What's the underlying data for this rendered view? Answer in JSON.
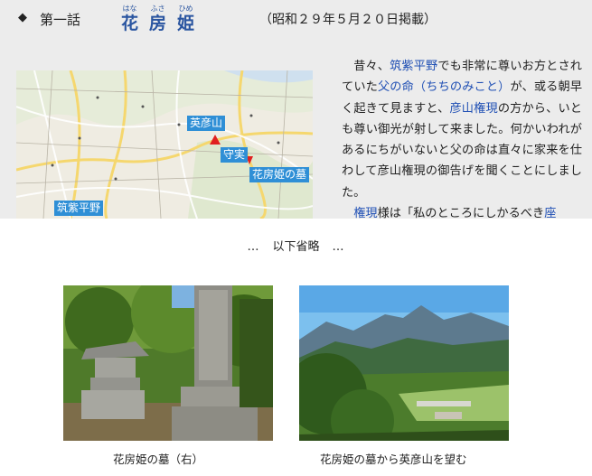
{
  "header": {
    "marker_icon": "diamond",
    "episode_label": "第一話",
    "title_chars": [
      {
        "rb": "花",
        "rt": "はな"
      },
      {
        "rb": "房",
        "rt": "ふさ"
      },
      {
        "rb": "姫",
        "rt": "ひめ"
      }
    ],
    "date": "（昭和２９年５月２０日掲載）"
  },
  "map": {
    "labels": {
      "hikosan": "英彦山",
      "moriza": "守実",
      "tomb": "花房姫の墓",
      "chikushi": "筑紫平野"
    },
    "markers": {
      "hikosan_color": "#e02020",
      "tomb_color": "#e02020"
    }
  },
  "story": {
    "p1": [
      {
        "t": "昔々、"
      },
      {
        "t": "筑紫平野",
        "hl": true
      },
      {
        "t": "でも非常に尊いお方とされていた"
      },
      {
        "t": "父の命（ちちのみこと）",
        "hl": true
      },
      {
        "t": "が、或る朝早く起きて見ますと、"
      },
      {
        "t": "彦山権現",
        "hl": true
      },
      {
        "t": "の方から、いとも尊い御光が射して来ました。何かいわれがあるにちがいないと父の命は直々に家来を仕わして彦山権現の御告げを聞くことにしました。"
      }
    ],
    "p2": [
      {
        "t": "権現",
        "hl": true
      },
      {
        "t": "様は「私のところにしかるべき"
      },
      {
        "t": "座",
        "hl": true
      }
    ]
  },
  "omitted": {
    "dots_left": "…",
    "text": "以下省略",
    "dots_right": "…"
  },
  "photos": [
    {
      "caption": "花房姫の墓（右）"
    },
    {
      "caption": "花房姫の墓から英彦山を望む"
    }
  ],
  "colors": {
    "accent": "#2a55a0",
    "link": "#1f4fb4",
    "band": "#ececec",
    "map_label_bg": "#2f8fd6"
  }
}
